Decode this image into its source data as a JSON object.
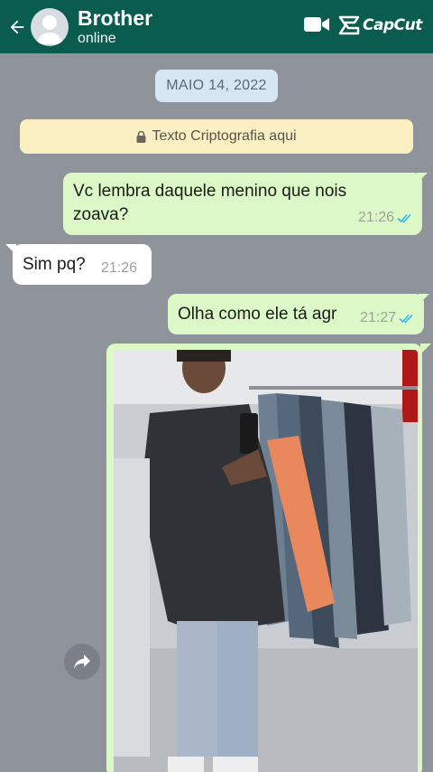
{
  "header": {
    "contact_name": "Brother",
    "status": "online",
    "watermark": "CapCut",
    "bg_color": "#0a5c4f"
  },
  "icons": {
    "back": "arrow-left-icon",
    "video": "video-call-icon",
    "lock": "lock-icon",
    "share": "forward-icon"
  },
  "chat": {
    "date_label": "MAIO 14, 2022",
    "encryption_notice": "Texto Criptografia aqui",
    "messages": [
      {
        "direction": "out",
        "text_line1": "Vc lembra daquele menino que nois",
        "text_line2": "zoava?",
        "time": "21:26",
        "read": true
      },
      {
        "direction": "in",
        "text": "Sim pq?",
        "time": "21:26"
      },
      {
        "direction": "out",
        "text": "Olha como ele tá agr",
        "time": "21:27",
        "read": true
      }
    ],
    "outgoing_color": "#dcf8c6",
    "incoming_color": "#ffffff",
    "read_tick_color": "#34b7f1"
  }
}
